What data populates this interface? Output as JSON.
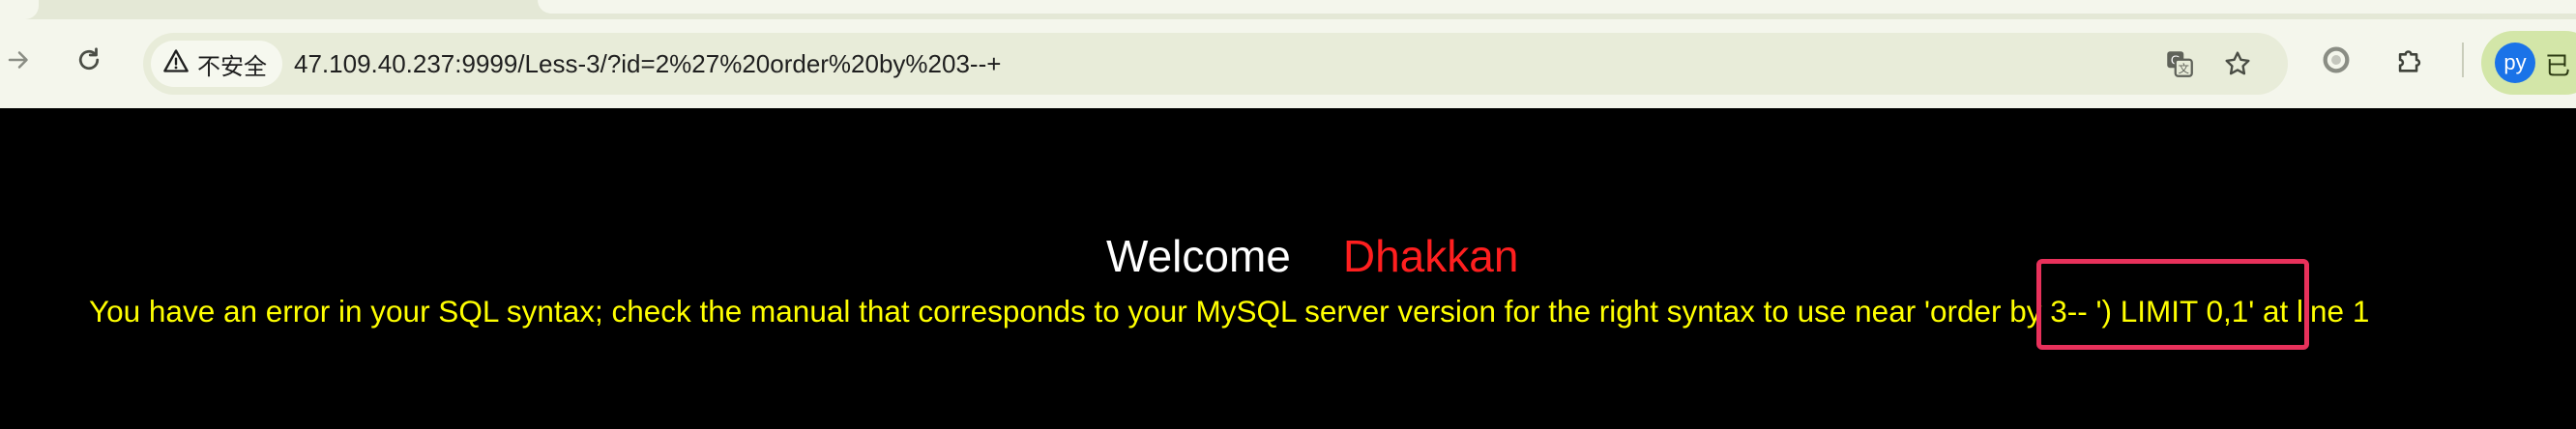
{
  "browser": {
    "security_label": "不安全",
    "url": "47.109.40.237:9999/Less-3/?id=2%27%20order%20by%203--+",
    "profile": {
      "avatar_initials": "py",
      "status_text": "已"
    },
    "icons": {
      "back": "arrow-back-icon",
      "forward": "arrow-forward-icon",
      "reload": "reload-icon",
      "warning": "warning-icon",
      "translate": "translate-icon",
      "bookmark": "star-icon",
      "extension_circle": "circle-extension-icon",
      "extensions": "puzzle-icon"
    }
  },
  "page": {
    "welcome_text": "Welcome",
    "name_text": "Dhakkan",
    "error_message": "You have an error in your SQL syntax; check the manual that corresponds to your MySQL server version for the right syntax to use near 'order by 3-- ') LIMIT 0,1' at line 1"
  },
  "colors": {
    "page_background": "#000000",
    "welcome": "#ffffff",
    "name": "#ff1f1f",
    "error": "#ffff00",
    "annotation_box": "#e8315b",
    "chrome_background": "#f4f6ec",
    "omnibox_background": "#e8ecd9",
    "profile_chip": "#d3e6a8"
  }
}
